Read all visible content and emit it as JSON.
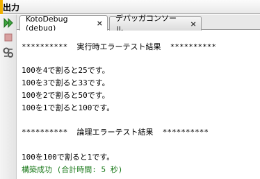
{
  "window": {
    "title": "出力"
  },
  "toolbar": {
    "icons": [
      "rerun-icon",
      "stop-icon",
      "settings-icon"
    ]
  },
  "tabs": [
    {
      "label": "KotoDebug (debug)",
      "close": "×",
      "active": true
    },
    {
      "label": "デバッガコンソール",
      "close": "×",
      "active": false
    }
  ],
  "console": {
    "lines": [
      "**********  実行時エラーテスト結果  **********",
      "100を4で割ると25です。",
      "100を3で割ると33です。",
      "100を2で割ると50です。",
      "100を1で割ると100です。",
      "**********  論理エラーテスト結果  **********",
      "100を100で割ると1です。",
      "構築成功 (合計時間: 5 秒)"
    ]
  },
  "colors": {
    "success_text": "#1b7a1b",
    "title_accent": "#f0b000"
  }
}
